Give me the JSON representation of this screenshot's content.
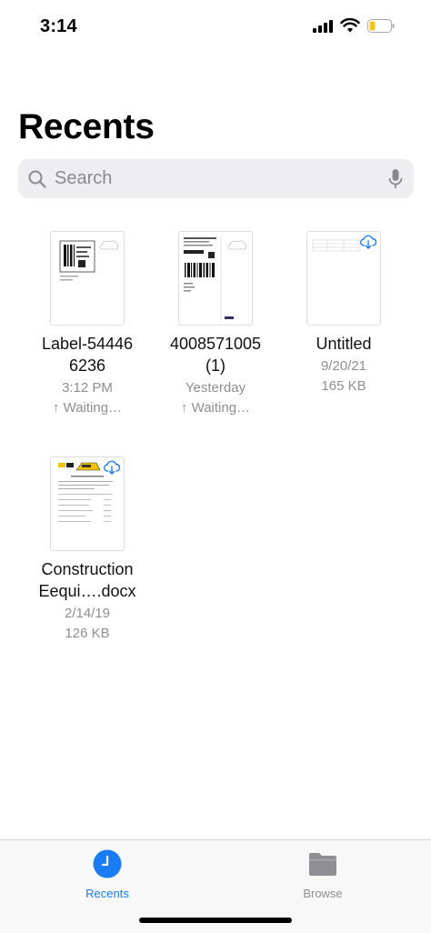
{
  "status": {
    "time": "3:14"
  },
  "header": {
    "title": "Recents"
  },
  "search": {
    "placeholder": "Search"
  },
  "files": [
    {
      "name_line1": "Label-54446",
      "name_line2": "6236",
      "meta1": "3:12 PM",
      "meta2": "↑ Waiting…"
    },
    {
      "name_line1": "4008571005",
      "name_line2": "(1)",
      "meta1": "Yesterday",
      "meta2": "↑ Waiting…"
    },
    {
      "name_line1": "Untitled",
      "name_line2": "",
      "meta1": "9/20/21",
      "meta2": "165 KB"
    },
    {
      "name_line1": "Construction",
      "name_line2": "Eequi….docx",
      "meta1": "2/14/19",
      "meta2": "126 KB"
    }
  ],
  "tabs": [
    {
      "label": "Recents"
    },
    {
      "label": "Browse"
    }
  ],
  "colors": {
    "accent": "#1a7cf5",
    "inactive": "#8e8e93",
    "battery": "#f5c518"
  }
}
